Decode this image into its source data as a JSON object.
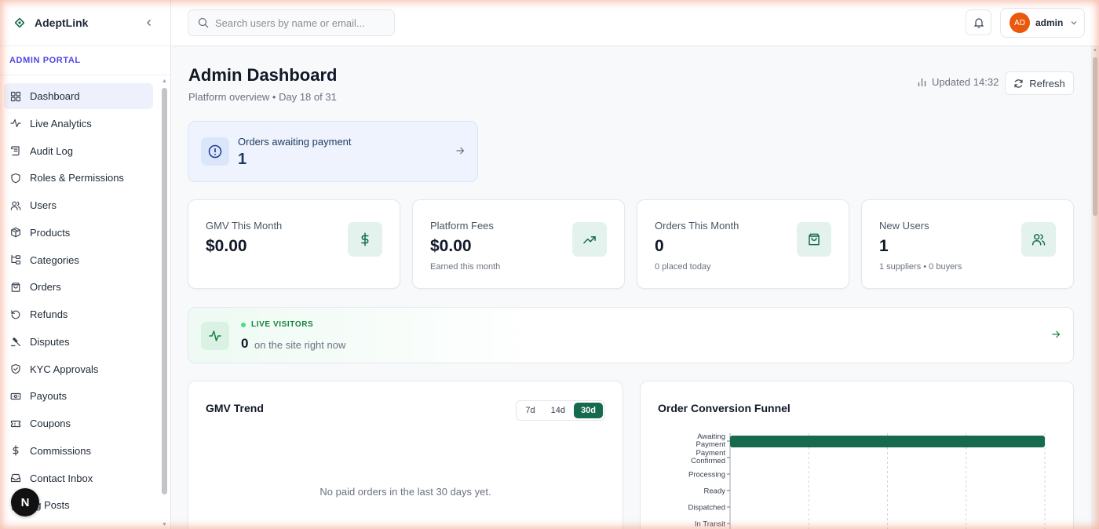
{
  "brand": {
    "name": "AdeptLink"
  },
  "sidebar": {
    "section_label": "ADMIN PORTAL",
    "items": [
      {
        "label": "Dashboard",
        "icon": "layout-grid-icon",
        "active": true
      },
      {
        "label": "Live Analytics",
        "icon": "activity-icon"
      },
      {
        "label": "Audit Log",
        "icon": "scroll-icon"
      },
      {
        "label": "Roles & Permissions",
        "icon": "shield-icon"
      },
      {
        "label": "Users",
        "icon": "users-icon"
      },
      {
        "label": "Products",
        "icon": "package-icon"
      },
      {
        "label": "Categories",
        "icon": "folder-tree-icon"
      },
      {
        "label": "Orders",
        "icon": "shopping-bag-icon"
      },
      {
        "label": "Refunds",
        "icon": "rotate-ccw-icon"
      },
      {
        "label": "Disputes",
        "icon": "gavel-icon"
      },
      {
        "label": "KYC Approvals",
        "icon": "shield-check-icon"
      },
      {
        "label": "Payouts",
        "icon": "banknote-icon"
      },
      {
        "label": "Coupons",
        "icon": "ticket-icon"
      },
      {
        "label": "Commissions",
        "icon": "dollar-sign-icon"
      },
      {
        "label": "Contact Inbox",
        "icon": "inbox-icon"
      },
      {
        "label": "og Posts",
        "icon": "file-text-icon"
      }
    ]
  },
  "header": {
    "search_placeholder": "Search users by name or email...",
    "avatar_initials": "AD",
    "user_name": "admin"
  },
  "page": {
    "title": "Admin Dashboard",
    "subtitle": "Platform overview • Day 18 of 31",
    "updated": "Updated 14:32",
    "refresh_label": "Refresh"
  },
  "alert": {
    "title": "Orders awaiting payment",
    "value": "1"
  },
  "stats": [
    {
      "label": "GMV This Month",
      "value": "$0.00",
      "sub": "",
      "icon": "dollar-sign-icon"
    },
    {
      "label": "Platform Fees",
      "value": "$0.00",
      "sub": "Earned this month",
      "icon": "trending-up-icon"
    },
    {
      "label": "Orders This Month",
      "value": "0",
      "sub": "0 placed today",
      "icon": "shopping-bag-icon"
    },
    {
      "label": "New Users",
      "value": "1",
      "sub": "1 suppliers • 0 buyers",
      "icon": "users-icon"
    }
  ],
  "live": {
    "label": "LIVE VISITORS",
    "value": "0",
    "text": "on the site right now"
  },
  "gmv_trend": {
    "title": "GMV Trend",
    "ranges": [
      "7d",
      "14d",
      "30d"
    ],
    "active_range": "30d",
    "empty_message": "No paid orders in the last 30 days yet."
  },
  "funnel": {
    "title": "Order Conversion Funnel",
    "chart_data": {
      "type": "bar",
      "orientation": "horizontal",
      "categories": [
        [
          "Awaiting",
          "Payment"
        ],
        [
          "Payment",
          "Confirmed"
        ],
        [
          "Processing"
        ],
        [
          "Ready"
        ],
        [
          "Dispatched"
        ],
        [
          "In Transit"
        ]
      ],
      "values": [
        1,
        0,
        0,
        0,
        0,
        0
      ],
      "xlim": [
        0,
        1
      ],
      "grid": true,
      "bar_color": "#166a4e"
    }
  }
}
